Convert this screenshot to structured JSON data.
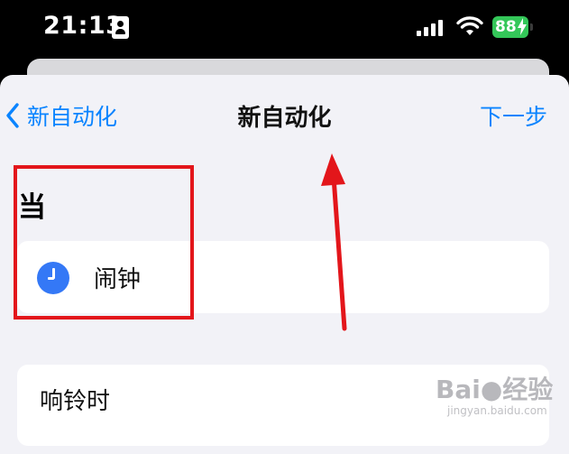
{
  "status_bar": {
    "time": "21:13",
    "battery": "88"
  },
  "nav": {
    "back_label": "新自动化",
    "title": "新自动化",
    "next_label": "下一步"
  },
  "section": {
    "header": "当"
  },
  "trigger": {
    "label": "闹钟",
    "icon": "clock-icon"
  },
  "option": {
    "label": "响铃时"
  },
  "annotation": {
    "box_color": "#e3161b",
    "arrow_color": "#e3161b"
  },
  "watermark": {
    "brand": "Bai",
    "brand_suffix": "经验",
    "url": "jingyan.baidu.com"
  },
  "colors": {
    "accent": "#0a84ff",
    "clock": "#3478f6",
    "battery": "#34c759"
  }
}
